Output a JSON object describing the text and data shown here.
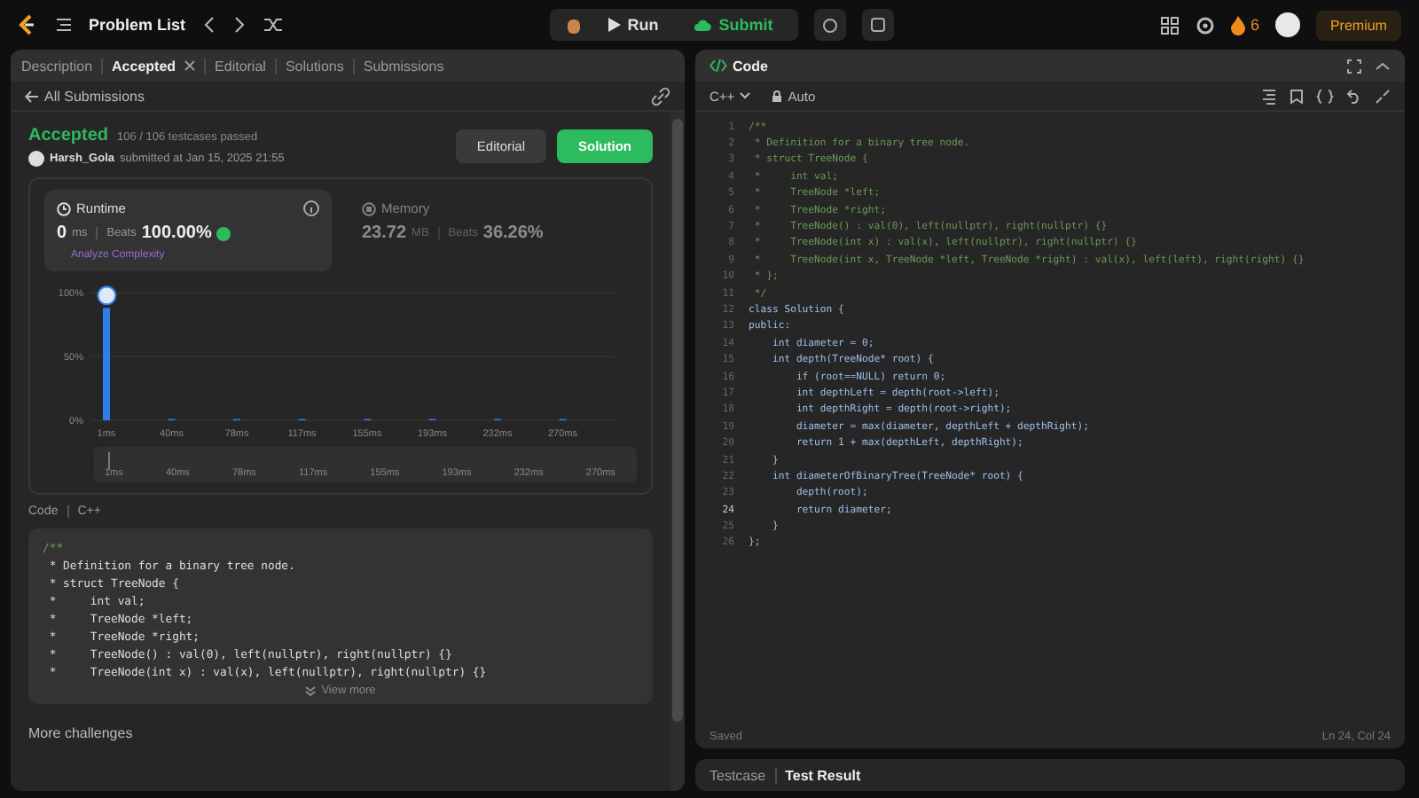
{
  "topbar": {
    "title": "Problem List",
    "run": "Run",
    "submit": "Submit",
    "streak": "6",
    "premium": "Premium"
  },
  "left_tabs": [
    {
      "label": "Description",
      "selected": false,
      "closable": false
    },
    {
      "label": "Accepted",
      "selected": true,
      "closable": true
    },
    {
      "label": "Editorial",
      "selected": false,
      "closable": false
    },
    {
      "label": "Solutions",
      "selected": false,
      "closable": false
    },
    {
      "label": "Submissions",
      "selected": false,
      "closable": false
    }
  ],
  "back_link": "All Submissions",
  "result": {
    "status": "Accepted",
    "testcases": "106 / 106 testcases passed",
    "user": "Harsh_Gola",
    "submitted": "submitted at Jan 15, 2025 21:55",
    "editorial": "Editorial",
    "solution": "Solution"
  },
  "runtime": {
    "label": "Runtime",
    "value": "0",
    "unit": "ms",
    "beats_label": "Beats",
    "beats": "100.00%",
    "link": "Analyze Complexity",
    "selected": true
  },
  "memory": {
    "label": "Memory",
    "value": "23.72",
    "unit": "MB",
    "beats_label": "Beats",
    "beats": "36.26%",
    "selected": false
  },
  "chart_data": {
    "type": "bar",
    "categories": [
      "1ms",
      "40ms",
      "78ms",
      "117ms",
      "155ms",
      "193ms",
      "232ms",
      "270ms"
    ],
    "values": [
      88,
      1,
      1,
      1,
      1,
      1,
      1,
      1
    ],
    "ylim": [
      0,
      100
    ],
    "yticks": [
      {
        "value": 0,
        "label": "0%"
      },
      {
        "value": 50,
        "label": "50%"
      },
      {
        "value": 100,
        "label": "100%"
      }
    ]
  },
  "overview_labels": [
    "1ms",
    "40ms",
    "78ms",
    "117ms",
    "155ms",
    "193ms",
    "232ms",
    "270ms"
  ],
  "code_header": {
    "label": "Code",
    "language": "C++"
  },
  "code_preview": [
    "/**",
    " * Definition for a binary tree node.",
    " * struct TreeNode {",
    " *     int val;",
    " *     TreeNode *left;",
    " *     TreeNode *right;",
    " *     TreeNode() : val(0), left(nullptr), right(nullptr) {}",
    " *     TreeNode(int x) : val(x), left(nullptr), right(nullptr) {}"
  ],
  "view_more": "View more",
  "more_challenges": "More challenges",
  "editor": {
    "title": "Code",
    "language": "C++",
    "mode": "Auto",
    "status": "Saved",
    "cursor": "Ln 24, Col 24",
    "lines": [
      {
        "n": "1",
        "text": "/**",
        "kind": "comment",
        "current": false
      },
      {
        "n": "2",
        "text": " * Definition for a binary tree node.",
        "kind": "comment",
        "current": false
      },
      {
        "n": "3",
        "text": " * struct TreeNode {",
        "kind": "comment",
        "current": false
      },
      {
        "n": "4",
        "text": " *     int val;",
        "kind": "comment",
        "current": false
      },
      {
        "n": "5",
        "text": " *     TreeNode *left;",
        "kind": "comment",
        "current": false
      },
      {
        "n": "6",
        "text": " *     TreeNode *right;",
        "kind": "comment",
        "current": false
      },
      {
        "n": "7",
        "text": " *     TreeNode() : val(0), left(nullptr), right(nullptr) {}",
        "kind": "comment",
        "current": false
      },
      {
        "n": "8",
        "text": " *     TreeNode(int x) : val(x), left(nullptr), right(nullptr) {}",
        "kind": "comment",
        "current": false
      },
      {
        "n": "9",
        "text": " *     TreeNode(int x, TreeNode *left, TreeNode *right) : val(x), left(left), right(right) {}",
        "kind": "comment",
        "current": false
      },
      {
        "n": "10",
        "text": " * };",
        "kind": "comment",
        "current": false
      },
      {
        "n": "11",
        "text": " */",
        "kind": "comment",
        "current": false
      },
      {
        "n": "12",
        "text": "class Solution {",
        "kind": "code",
        "current": false
      },
      {
        "n": "13",
        "text": "public:",
        "kind": "code",
        "current": false
      },
      {
        "n": "14",
        "text": "    int diameter = 0;",
        "kind": "code",
        "current": false
      },
      {
        "n": "15",
        "text": "    int depth(TreeNode* root) {",
        "kind": "code",
        "current": false
      },
      {
        "n": "16",
        "text": "        if (root==NULL) return 0;",
        "kind": "code",
        "current": false
      },
      {
        "n": "17",
        "text": "        int depthLeft = depth(root->left);",
        "kind": "code",
        "current": false
      },
      {
        "n": "18",
        "text": "        int depthRight = depth(root->right);",
        "kind": "code",
        "current": false
      },
      {
        "n": "19",
        "text": "        diameter = max(diameter, depthLeft + depthRight);",
        "kind": "code",
        "current": false
      },
      {
        "n": "20",
        "text": "        return 1 + max(depthLeft, depthRight);",
        "kind": "code",
        "current": false
      },
      {
        "n": "21",
        "text": "    }",
        "kind": "code",
        "current": false
      },
      {
        "n": "22",
        "text": "    int diameterOfBinaryTree(TreeNode* root) {",
        "kind": "code",
        "current": false
      },
      {
        "n": "23",
        "text": "        depth(root);",
        "kind": "code",
        "current": false
      },
      {
        "n": "24",
        "text": "        return diameter;",
        "kind": "code",
        "current": true
      },
      {
        "n": "25",
        "text": "    }",
        "kind": "code",
        "current": false
      },
      {
        "n": "26",
        "text": "};",
        "kind": "code",
        "current": false
      }
    ]
  },
  "bottom_tabs": [
    {
      "label": "Testcase",
      "selected": false
    },
    {
      "label": "Test Result",
      "selected": true
    }
  ]
}
